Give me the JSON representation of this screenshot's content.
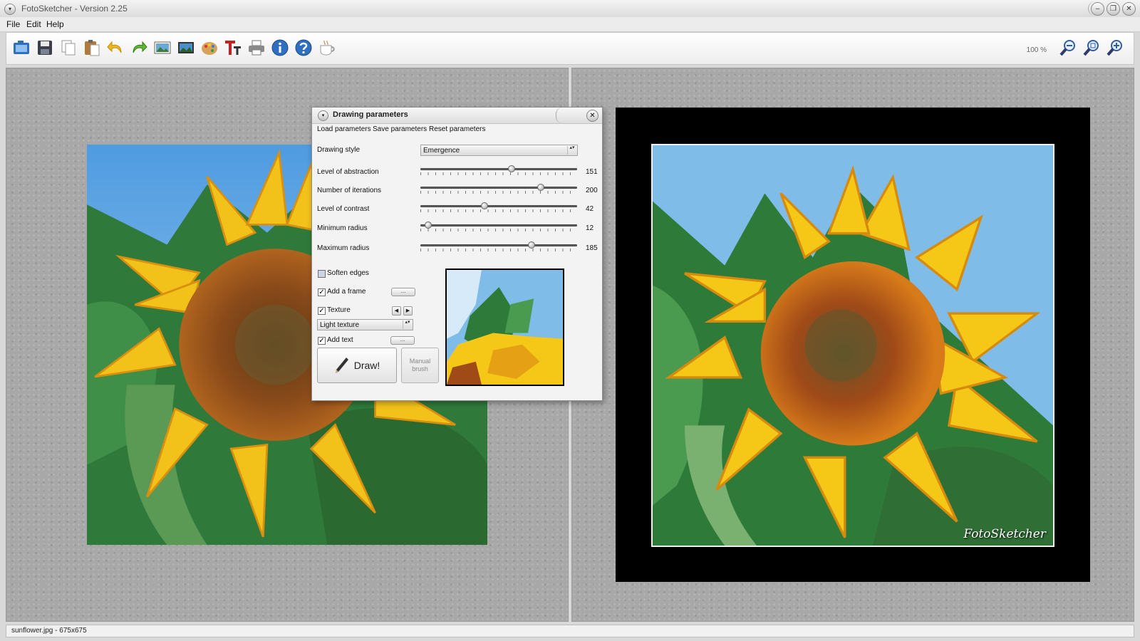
{
  "window": {
    "title": "FotoSketcher - Version 2.25",
    "menu_glyph": "▾",
    "minimize_glyph": "–",
    "restore_glyph": "❐",
    "close_glyph": "✕"
  },
  "menubar": {
    "items": [
      "File",
      "Edit",
      "Help"
    ]
  },
  "toolbar": {
    "buttons": [
      {
        "icon": "open-icon"
      },
      {
        "icon": "save-icon"
      },
      {
        "icon": "copy-icon"
      },
      {
        "icon": "paste-icon"
      },
      {
        "icon": "undo-icon"
      },
      {
        "icon": "redo-icon"
      },
      {
        "icon": "original-image-icon"
      },
      {
        "icon": "result-image-icon"
      },
      {
        "icon": "palette-icon"
      },
      {
        "icon": "text-icon"
      },
      {
        "icon": "print-icon"
      },
      {
        "icon": "info-icon"
      },
      {
        "icon": "help-icon"
      },
      {
        "icon": "coffee-icon"
      }
    ],
    "zoom_level": "100 %",
    "zoom_buttons": [
      {
        "icon": "zoom-out-icon"
      },
      {
        "icon": "zoom-reset-icon"
      },
      {
        "icon": "zoom-in-icon"
      }
    ]
  },
  "result": {
    "watermark": "FotoSketcher"
  },
  "dialog": {
    "title": "Drawing parameters",
    "title_glyph": "▾",
    "close_glyph": "✕",
    "menu": [
      "Load parameters",
      "Save parameters",
      "Reset parameters"
    ],
    "drawing_style_label": "Drawing style",
    "drawing_style_value": "Emergence",
    "combo_arrow": "▴▾",
    "sliders": [
      {
        "label": "Level of abstraction",
        "value": 151,
        "fraction": 0.58
      },
      {
        "label": "Number of iterations",
        "value": 200,
        "fraction": 0.77
      },
      {
        "label": "Level of contrast",
        "value": 42,
        "fraction": 0.41
      },
      {
        "label": "Minimum radius",
        "value": 12,
        "fraction": 0.05
      },
      {
        "label": "Maximum radius",
        "value": 185,
        "fraction": 0.71
      }
    ],
    "soften_edges": {
      "label": "Soften edges",
      "checked": false
    },
    "add_frame": {
      "label": "Add a frame",
      "checked": true,
      "button": "..."
    },
    "texture": {
      "label": "Texture",
      "checked": true,
      "prev": "◀",
      "next": "▶"
    },
    "texture_value": "Light texture",
    "add_text": {
      "label": "Add text",
      "checked": true,
      "button": "..."
    },
    "check_mark": "✓",
    "draw_button": "Draw!",
    "manual_brush": "Manual brush"
  },
  "statusbar": {
    "text": "sunflower.jpg - 675x675"
  },
  "colors": {
    "sky": "#6fb0e8",
    "petal": "#f2c21a",
    "petal_dark": "#d9900f",
    "center": "#8a4a1a",
    "leaf": "#2f7a3a",
    "panel_bg": "#a8a8a8"
  }
}
